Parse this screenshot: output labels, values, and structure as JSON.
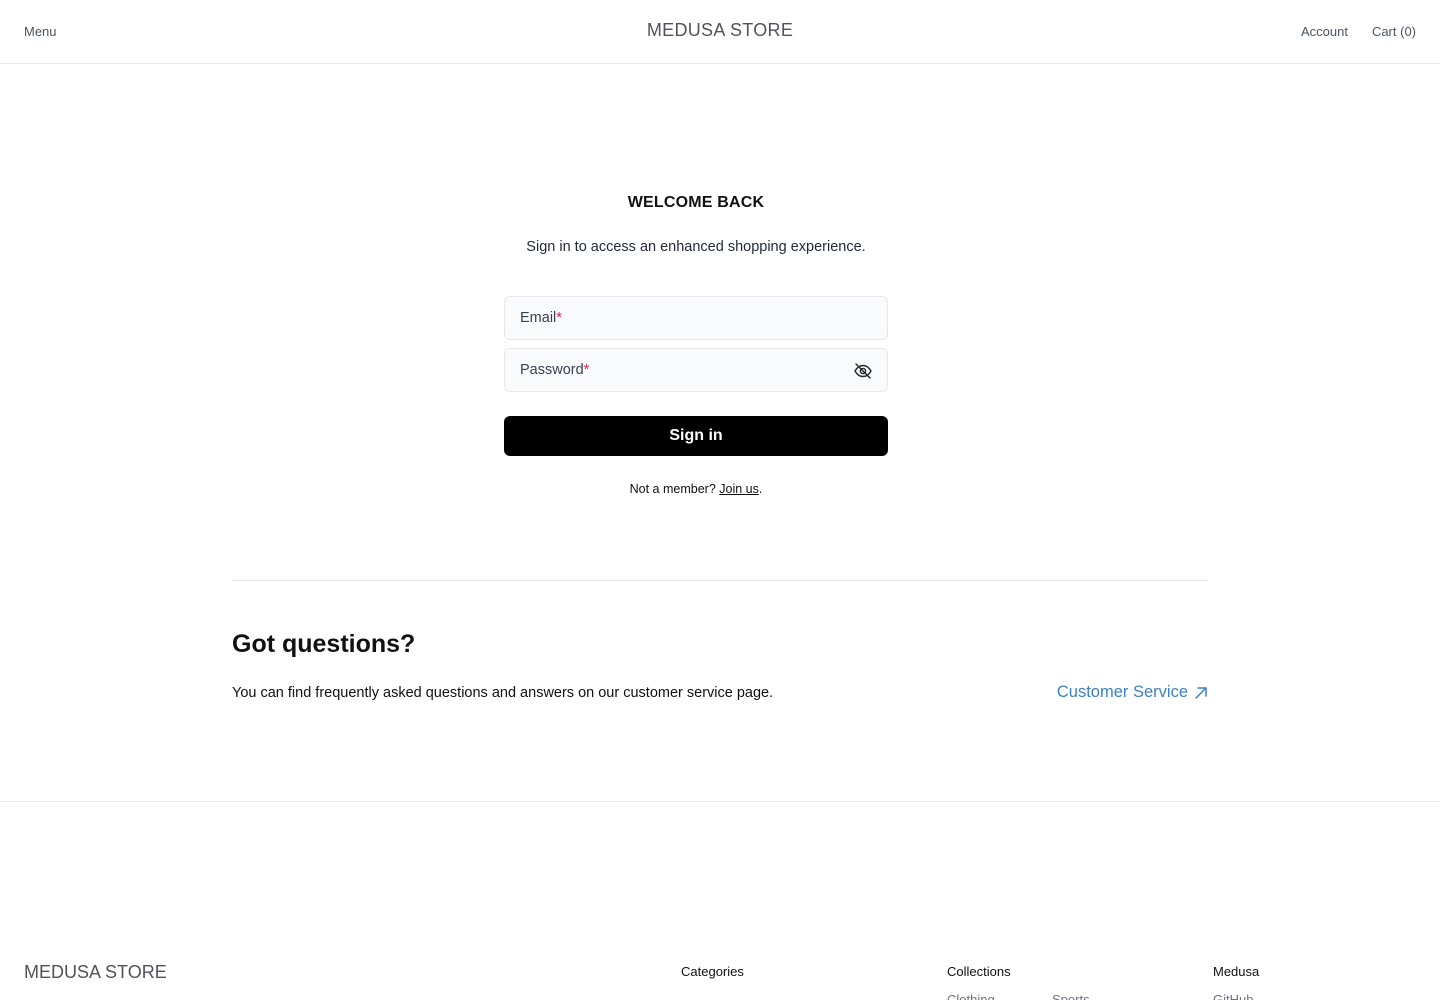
{
  "header": {
    "menu_label": "Menu",
    "brand": "MEDUSA STORE",
    "account_label": "Account",
    "cart_label": "Cart (0)"
  },
  "login": {
    "title": "WELCOME BACK",
    "subtitle": "Sign in to access an enhanced shopping experience.",
    "email_label": "Email",
    "password_label": "Password",
    "required_mark": "*",
    "password_toggle_icon": "eye-off-icon",
    "signin_label": "Sign in",
    "not_member_text": "Not a member?",
    "join_label": "Join us",
    "period": "."
  },
  "faq": {
    "title": "Got questions?",
    "text": "You can find frequently asked questions and answers on our customer service page.",
    "link_label": "Customer Service",
    "link_icon": "arrow-up-right-icon",
    "link_color": "#3b82c4"
  },
  "footer": {
    "brand": "MEDUSA STORE",
    "categories_heading": "Categories",
    "collections_heading": "Collections",
    "medusa_heading": "Medusa",
    "collections": [
      "Clothing",
      "Sports"
    ],
    "medusa_links": [
      "GitHub"
    ]
  }
}
